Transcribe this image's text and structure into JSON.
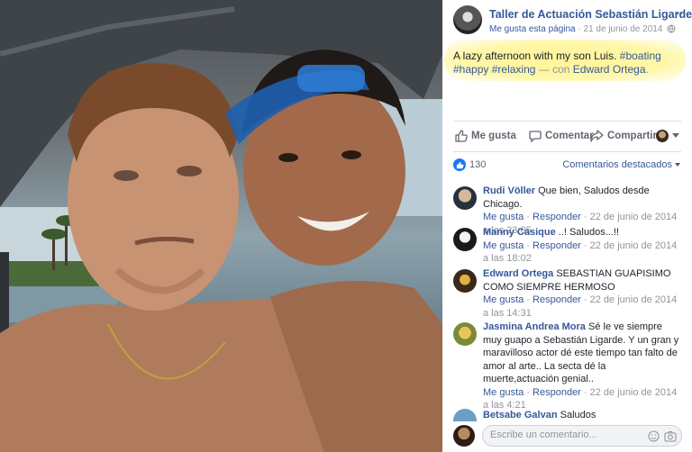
{
  "post": {
    "page_name": "Taller de Actuación Sebastián Ligarde",
    "like_page": "Me gusta esta página",
    "date": "21 de junio de 2014",
    "more": "···",
    "caption_text": "A lazy afternoon with my son Luis.",
    "hashtag_boating": "#boating",
    "hashtag_happy": "#happy",
    "hashtag_relaxing": "#relaxing",
    "with_text": "— con",
    "tagged_person": "Edward Ortega",
    "period": "."
  },
  "actions": {
    "like": "Me gusta",
    "comment": "Comentar",
    "share": "Compartir"
  },
  "stats": {
    "likes": "130",
    "sort": "Comentarios destacados"
  },
  "comments": [
    {
      "name": "Rudi Völler",
      "text": "Que bien, Saludos desde Chicago.",
      "like": "Me gusta",
      "reply": "Responder",
      "time": "22 de junio de 2014 a las 23:05"
    },
    {
      "name": "Manny Casique",
      "text": "..! Saludos...!!",
      "like": "Me gusta",
      "reply": "Responder",
      "time": "22 de junio de 2014 a las 18:02"
    },
    {
      "name": "Edward Ortega",
      "text": "SEBASTIAN GUAPISIMO COMO SIEMPRE HERMOSO",
      "like": "Me gusta",
      "reply": "Responder",
      "time": "22 de junio de 2014 a las 14:31"
    },
    {
      "name": "Jasmina Andrea Mora",
      "text": "Sé le ve siempre muy guapo a Sebastián Ligarde. Y un gran y maravilloso actor dé este tiempo tan falto de amor al arte.. La secta dé la muerte,actuación genial..",
      "like": "Me gusta",
      "reply": "Responder",
      "time": "22 de junio de 2014 a las 4:21"
    },
    {
      "name": "Betsabe Galvan",
      "text": "Saludos"
    }
  ],
  "composer": {
    "placeholder": "Escribe un comentario..."
  },
  "colors": {
    "link": "#365899",
    "muted": "#90949c",
    "highlight": "#fff59a",
    "like_blue": "#1877f2"
  }
}
